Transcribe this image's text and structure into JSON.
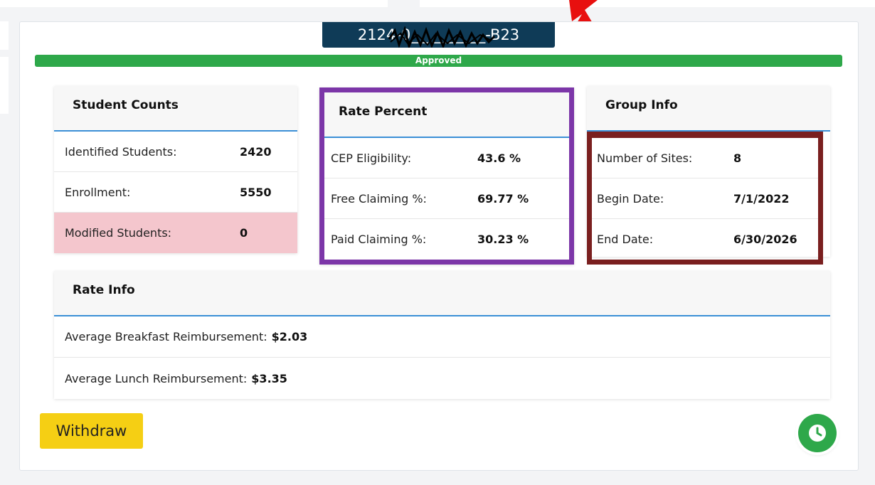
{
  "application": {
    "id": "2124-0__________-B23",
    "status": "Approved"
  },
  "student_counts": {
    "title": "Student Counts",
    "rows": [
      {
        "label": "Identified Students:",
        "value": "2420"
      },
      {
        "label": "Enrollment:",
        "value": "5550"
      },
      {
        "label": "Modified Students:",
        "value": "0"
      }
    ]
  },
  "rate_percent": {
    "title": "Rate Percent",
    "rows": [
      {
        "label": "CEP Eligibility:",
        "value": "43.6 %"
      },
      {
        "label": "Free Claiming %:",
        "value": "69.77 %"
      },
      {
        "label": "Paid Claiming %:",
        "value": "30.23 %"
      }
    ]
  },
  "group_info": {
    "title": "Group Info",
    "rows": [
      {
        "label": "Number of Sites:",
        "value": "8"
      },
      {
        "label": "Begin Date:",
        "value": "7/1/2022"
      },
      {
        "label": "End Date:",
        "value": "6/30/2026"
      }
    ]
  },
  "rate_info": {
    "title": "Rate Info",
    "rows": [
      {
        "label": "Average Breakfast Reimbursement:",
        "value": "$2.03"
      },
      {
        "label": "Average Lunch Reimbursement:",
        "value": "$3.35"
      }
    ]
  },
  "actions": {
    "withdraw_label": "Withdraw"
  },
  "icons": {
    "history": "clock-icon",
    "annotation": "red-arrow-icon"
  },
  "colors": {
    "status_green": "#2ea84a",
    "id_banner": "#0f3b57",
    "rate_highlight_border": "#7c36a8",
    "group_highlight_border": "#7a1f1f",
    "modified_row": "#f4c6cd",
    "withdraw_button": "#f5cf14"
  }
}
